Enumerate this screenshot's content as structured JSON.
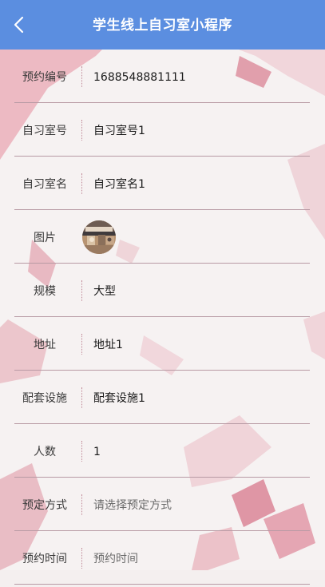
{
  "header": {
    "title": "学生线上自习室小程序",
    "back_icon": "chevron-left-icon",
    "color": "#5b8ee0"
  },
  "fields": [
    {
      "label": "预约编号",
      "value": "1688548881111"
    },
    {
      "label": "自习室号",
      "value": "自习室号1"
    },
    {
      "label": "自习室名",
      "value": "自习室名1"
    },
    {
      "label": "图片",
      "image": "study-room-photo"
    },
    {
      "label": "规模",
      "value": "大型"
    },
    {
      "label": "地址",
      "value": "地址1"
    },
    {
      "label": "配套设施",
      "value": "配套设施1"
    },
    {
      "label": "人数",
      "value": "1"
    },
    {
      "label": "预定方式",
      "placeholder": "请选择预定方式"
    },
    {
      "label": "预约时间",
      "placeholder": "预约时间"
    }
  ]
}
